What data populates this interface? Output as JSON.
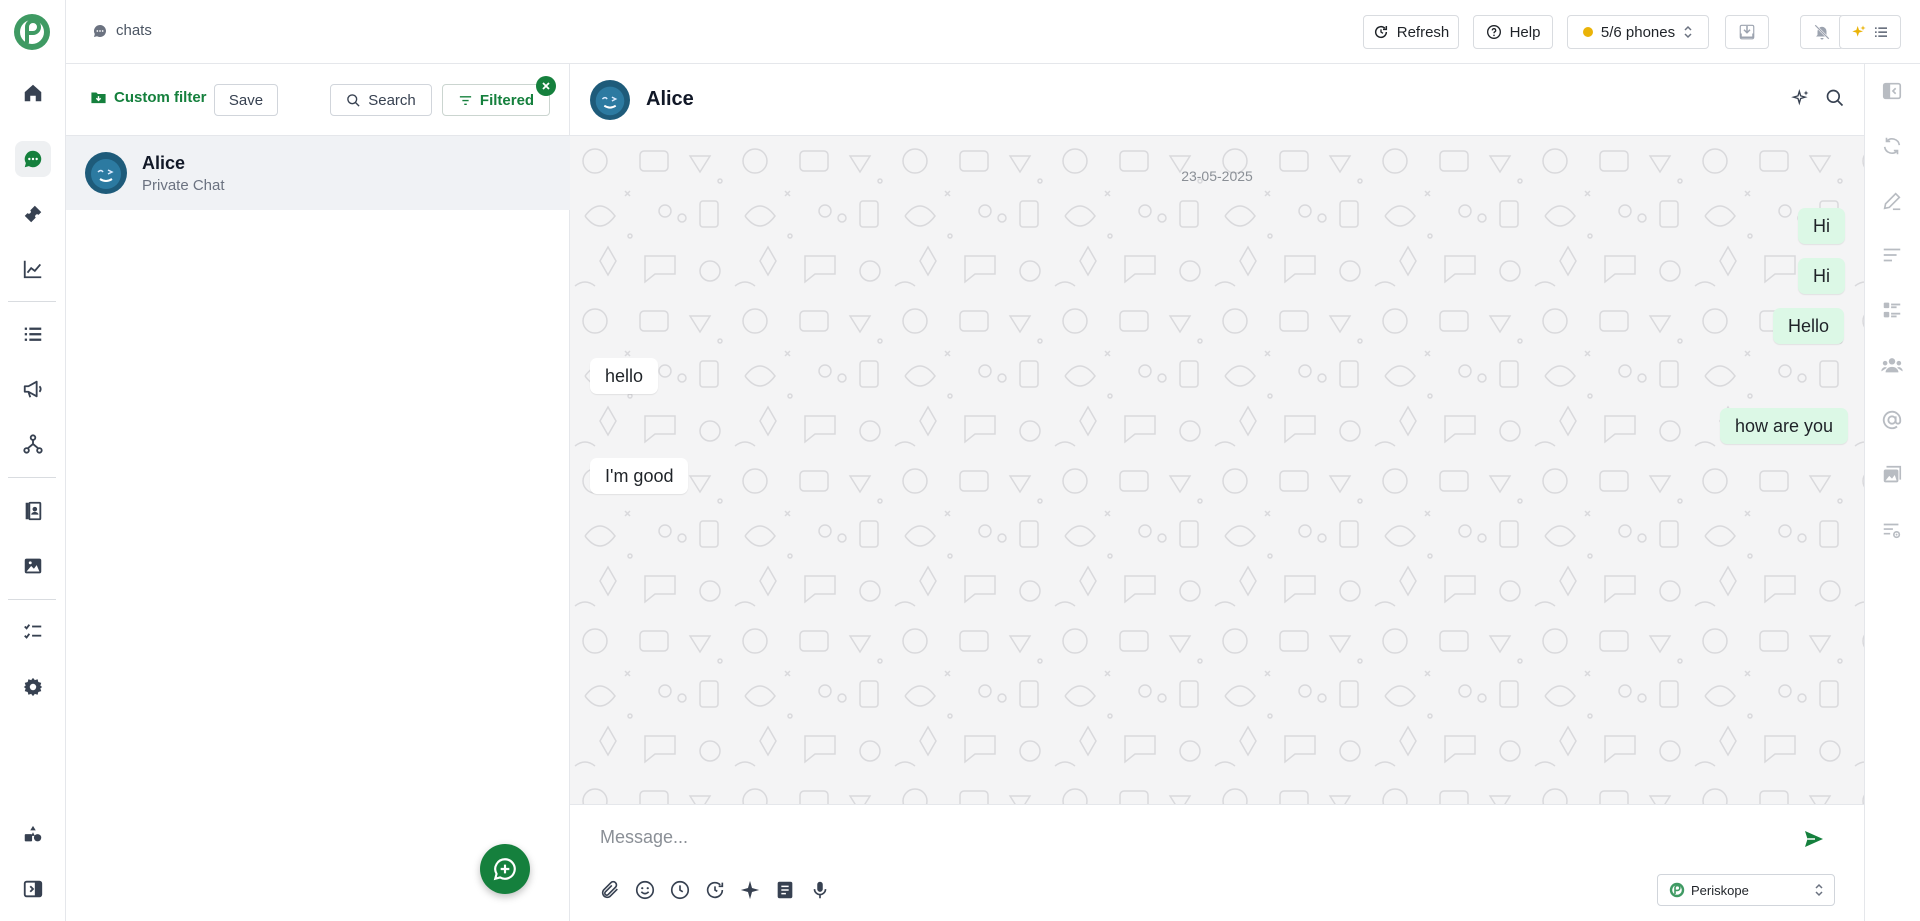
{
  "brand": {
    "accent": "#15803d",
    "logo_icon": "periskope-logo"
  },
  "rail": {
    "items": [
      {
        "name": "home",
        "icon": "home-icon"
      },
      {
        "name": "chats",
        "icon": "chat-bubble-icon",
        "active": true
      },
      {
        "name": "tickets",
        "icon": "ticket-icon"
      },
      {
        "name": "analytics",
        "icon": "line-chart-icon"
      },
      {
        "name": "lists",
        "icon": "list-icon"
      },
      {
        "name": "broadcast",
        "icon": "megaphone-icon"
      },
      {
        "name": "flows",
        "icon": "workflow-icon"
      },
      {
        "name": "contacts",
        "icon": "contacts-book-icon"
      },
      {
        "name": "media",
        "icon": "image-icon"
      },
      {
        "name": "tasks",
        "icon": "task-list-icon"
      },
      {
        "name": "settings",
        "icon": "gear-icon"
      },
      {
        "name": "integrations",
        "icon": "integrations-icon"
      },
      {
        "name": "collapse",
        "icon": "sidebar-toggle-icon"
      }
    ]
  },
  "topbar": {
    "breadcrumb": "chats",
    "refresh_label": "Refresh",
    "help_label": "Help",
    "phones_label": "5/6 phones",
    "phones_status_color": "#eab308"
  },
  "list": {
    "custom_filter_label": "Custom filter",
    "save_label": "Save",
    "search_label": "Search",
    "filtered_label": "Filtered",
    "chats": [
      {
        "name": "Alice",
        "subtitle": "Private Chat"
      }
    ]
  },
  "conversation": {
    "name": "Alice",
    "date": "23-05-2025",
    "messages": [
      {
        "text": "Hi",
        "direction": "out"
      },
      {
        "text": "Hi",
        "direction": "out"
      },
      {
        "text": "Hello",
        "direction": "out"
      },
      {
        "text": "hello",
        "direction": "in"
      },
      {
        "text": "how are you",
        "direction": "out"
      },
      {
        "text": "I'm good",
        "direction": "in"
      }
    ],
    "composer": {
      "placeholder": "Message...",
      "phone_select": "Periskope"
    }
  }
}
